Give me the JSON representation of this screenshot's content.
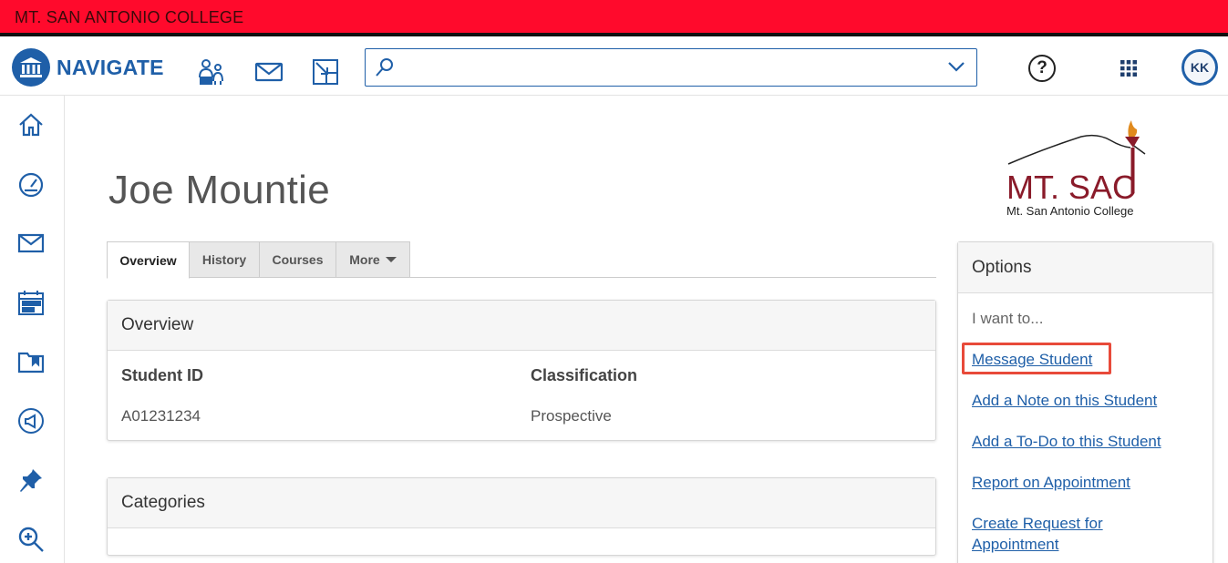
{
  "college_bar": {
    "title": "MT. SAN ANTONIO COLLEGE"
  },
  "brand": {
    "name": "NAVIGATE"
  },
  "search": {
    "value": "",
    "placeholder": ""
  },
  "user": {
    "initials": "KK"
  },
  "help": {
    "label": "?"
  },
  "student": {
    "name": "Joe Mountie"
  },
  "logo": {
    "wordmark": "MT. SAC",
    "subtitle": "Mt. San Antonio College"
  },
  "tabs": [
    {
      "label": "Overview",
      "active": true
    },
    {
      "label": "History",
      "active": false
    },
    {
      "label": "Courses",
      "active": false
    },
    {
      "label": "More",
      "active": false
    }
  ],
  "overview": {
    "title": "Overview",
    "fields": [
      {
        "label": "Student ID",
        "value": "A01231234"
      },
      {
        "label": "Classification",
        "value": "Prospective"
      }
    ]
  },
  "categories": {
    "title": "Categories"
  },
  "options": {
    "title": "Options",
    "intro": "I want to...",
    "links": [
      "Message Student",
      "Add a Note on this Student",
      "Add a To-Do to this Student",
      "Report on Appointment",
      "Create Request for Appointment"
    ]
  },
  "colors": {
    "brand_blue": "#1f5fa8",
    "college_red": "#ff0a2c",
    "highlight_red": "#e84a3a"
  },
  "icons": {
    "topnav": [
      "people-icon",
      "mail-icon",
      "expand-icon",
      "search-icon",
      "chevron-down-icon",
      "help-icon",
      "apps-grid-icon"
    ],
    "sidebar": [
      "home-icon",
      "dashboard-icon",
      "mail-icon",
      "calendar-icon",
      "folder-icon",
      "megaphone-icon",
      "pin-icon",
      "zoom-icon"
    ]
  }
}
